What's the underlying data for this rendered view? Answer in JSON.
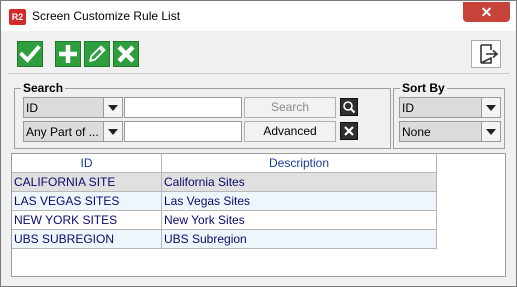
{
  "window": {
    "title": "Screen Customize Rule List",
    "app_icon_text": "R2",
    "close_glyph": "✕"
  },
  "toolbar": {
    "buttons": [
      {
        "name": "save-check-button",
        "icon": "check-icon"
      },
      {
        "name": "add-button",
        "icon": "plus-icon"
      },
      {
        "name": "edit-button",
        "icon": "pencil-icon"
      },
      {
        "name": "delete-button",
        "icon": "x-icon"
      }
    ],
    "exit_icon": "exit-icon"
  },
  "search": {
    "group_label": "Search",
    "field_combo_value": "ID",
    "match_combo_value": "Any Part of ...",
    "search_input_value": "",
    "advanced_input_value": "",
    "search_button_label": "Search",
    "advanced_button_label": "Advanced"
  },
  "sort": {
    "group_label": "Sort By",
    "field_combo_value": "ID",
    "order_combo_value": "None"
  },
  "grid": {
    "columns": [
      "ID",
      "Description"
    ],
    "rows": [
      {
        "id": "CALIFORNIA SITE",
        "description": "California Sites",
        "selected": true
      },
      {
        "id": "LAS VEGAS SITES",
        "description": "Las Vegas Sites",
        "selected": false
      },
      {
        "id": "NEW YORK SITES",
        "description": "New York Sites",
        "selected": false
      },
      {
        "id": "UBS SUBREGION",
        "description": "UBS Subregion",
        "selected": false
      }
    ]
  },
  "colors": {
    "toolbar_green": "#2e9e3e",
    "close_red": "#c7433a",
    "grid_text": "#0a0a6a"
  }
}
